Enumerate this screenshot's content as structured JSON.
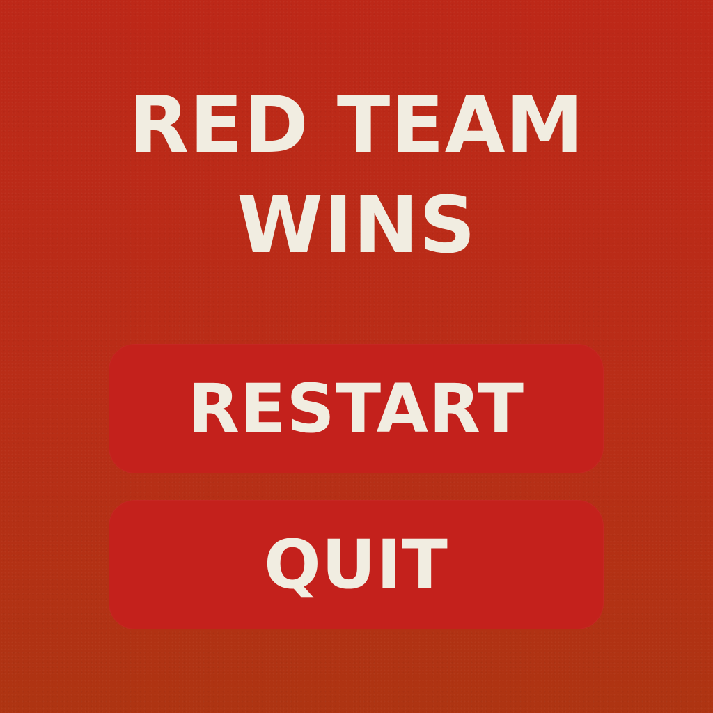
{
  "screen": {
    "title_line_1": "RED TEAM",
    "title_line_2": "WINS"
  },
  "menu": {
    "restart_label": "RESTART",
    "quit_label": "QUIT"
  },
  "colors": {
    "background": "#bd2818",
    "button": "#c4211c",
    "text": "#f1ede1"
  }
}
